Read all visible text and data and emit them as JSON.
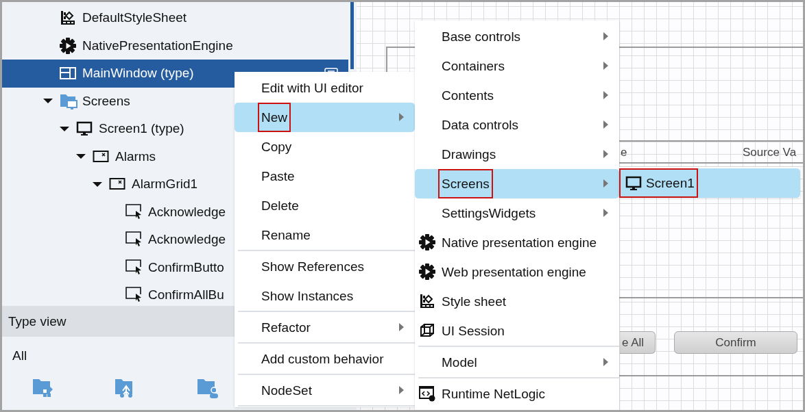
{
  "tree": {
    "items": [
      {
        "label": "DefaultStyleSheet",
        "kind": "stylesheet",
        "selected": false
      },
      {
        "label": "NativePresentationEngine",
        "kind": "engine",
        "selected": false
      },
      {
        "label": "MainWindow (type)",
        "kind": "window",
        "selected": true
      },
      {
        "label": "Screens",
        "kind": "folder",
        "selected": false,
        "expanded": true,
        "children": [
          {
            "label": "Screen1 (type)",
            "kind": "screen",
            "selected": false,
            "expanded": true,
            "children": [
              {
                "label": "Alarms",
                "kind": "panel",
                "selected": false,
                "expanded": true,
                "children": [
                  {
                    "label": "AlarmGrid1",
                    "kind": "panel",
                    "selected": false,
                    "expanded": true,
                    "children": [
                      {
                        "label": "Acknowledge",
                        "kind": "button",
                        "selected": false
                      },
                      {
                        "label": "Acknowledge",
                        "kind": "button",
                        "selected": false
                      },
                      {
                        "label": "ConfirmButto",
                        "kind": "button",
                        "selected": false
                      },
                      {
                        "label": "ConfirmAllBu",
                        "kind": "button",
                        "selected": false
                      }
                    ]
                  }
                ]
              }
            ]
          }
        ]
      }
    ]
  },
  "type_view": {
    "title": "Type view",
    "filter": "All"
  },
  "canvas": {
    "header_fragments": [
      "e",
      "Source Va"
    ],
    "buttons": [
      "e All",
      "Confirm"
    ]
  },
  "menus": [
    {
      "items": [
        {
          "label": "Edit with UI editor",
          "kind": "action",
          "selected": false,
          "outlined": false
        },
        {
          "label": "New",
          "kind": "submenu",
          "selected": true,
          "outlined": true
        },
        {
          "label": "Copy",
          "kind": "action",
          "selected": false,
          "outlined": false
        },
        {
          "label": "Paste",
          "kind": "action",
          "selected": false,
          "outlined": false
        },
        {
          "label": "Delete",
          "kind": "action",
          "selected": false,
          "outlined": false
        },
        {
          "label": "Rename",
          "kind": "action",
          "selected": false,
          "outlined": false
        },
        {
          "kind": "separator"
        },
        {
          "label": "Show References",
          "kind": "action",
          "selected": false,
          "outlined": false
        },
        {
          "label": "Show Instances",
          "kind": "action",
          "selected": false,
          "outlined": false
        },
        {
          "kind": "separator"
        },
        {
          "label": "Refactor",
          "kind": "submenu",
          "selected": false,
          "outlined": false
        },
        {
          "kind": "separator"
        },
        {
          "label": "Add custom behavior",
          "kind": "action",
          "selected": false,
          "outlined": false
        },
        {
          "kind": "separator"
        },
        {
          "label": "NodeSet",
          "kind": "submenu",
          "selected": false,
          "outlined": false
        },
        {
          "kind": "separator"
        }
      ]
    },
    {
      "items": [
        {
          "label": "Base controls",
          "kind": "submenu",
          "selected": false,
          "outlined": false
        },
        {
          "label": "Containers",
          "kind": "submenu",
          "selected": false,
          "outlined": false
        },
        {
          "label": "Contents",
          "kind": "submenu",
          "selected": false,
          "outlined": false
        },
        {
          "label": "Data controls",
          "kind": "submenu",
          "selected": false,
          "outlined": false
        },
        {
          "label": "Drawings",
          "kind": "submenu",
          "selected": false,
          "outlined": false
        },
        {
          "label": "Screens",
          "kind": "submenu",
          "selected": true,
          "outlined": true
        },
        {
          "label": "SettingsWidgets",
          "kind": "submenu",
          "selected": false,
          "outlined": false
        },
        {
          "label": "Native presentation engine",
          "kind": "engine",
          "selected": false,
          "outlined": false
        },
        {
          "label": "Web presentation engine",
          "kind": "engine",
          "selected": false,
          "outlined": false
        },
        {
          "label": "Style sheet",
          "kind": "stylesheet",
          "selected": false,
          "outlined": false
        },
        {
          "label": "UI Session",
          "kind": "session",
          "selected": false,
          "outlined": false
        },
        {
          "kind": "separator"
        },
        {
          "label": "Model",
          "kind": "submenu",
          "selected": false,
          "outlined": false
        },
        {
          "kind": "separator"
        },
        {
          "label": "Runtime NetLogic",
          "kind": "netlogic",
          "selected": false,
          "outlined": false
        }
      ]
    },
    {
      "items": [
        {
          "label": "Screen1",
          "kind": "screen",
          "selected": true,
          "outlined": true
        }
      ]
    }
  ]
}
